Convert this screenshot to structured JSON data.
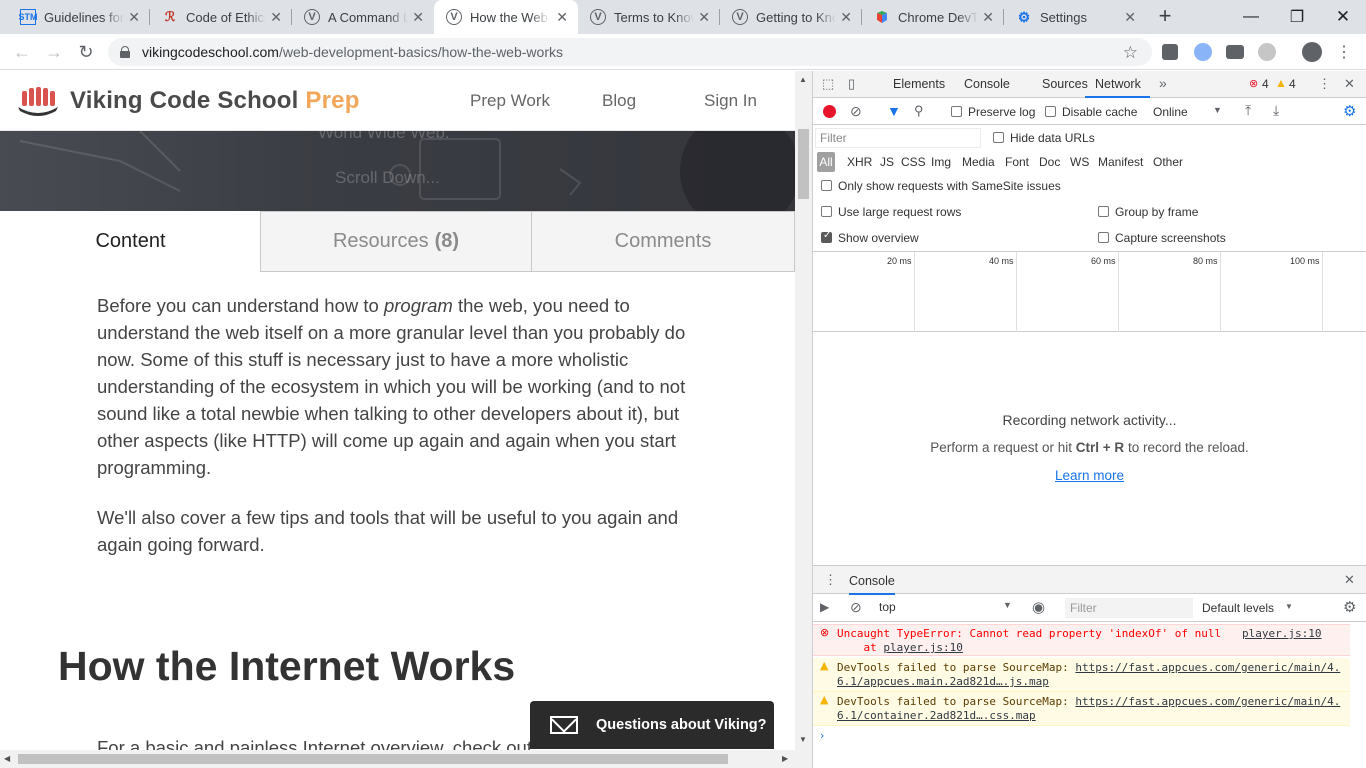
{
  "browser": {
    "tabs": [
      {
        "title": "Guidelines for Social Media",
        "favicon": "STM"
      },
      {
        "title": "Code of Ethics",
        "favicon": "ethics-icon"
      },
      {
        "title": "A Command Line Crash Course",
        "favicon": "V"
      },
      {
        "title": "How the Web Works",
        "favicon": "V",
        "active": true
      },
      {
        "title": "Terms to Know",
        "favicon": "V"
      },
      {
        "title": "Getting to Know",
        "favicon": "V"
      },
      {
        "title": "Chrome DevTools",
        "favicon": "devtools-icon"
      },
      {
        "title": "Settings",
        "favicon": "gear-icon"
      }
    ],
    "url_host": "vikingcodeschool.com",
    "url_path": "/web-development-basics/how-the-web-works"
  },
  "site": {
    "brand_name": "Viking Code School",
    "brand_suffix": "Prep",
    "nav": [
      "Prep Work",
      "Blog",
      "Sign In"
    ],
    "hero_faint_text": "World Wide Web.",
    "hero_scroll_text": "Scroll Down...",
    "content_tabs": [
      {
        "label": "Content"
      },
      {
        "label": "Resources",
        "count": "(8)"
      },
      {
        "label": "Comments"
      }
    ],
    "paragraph1_before": "Before you can understand how to ",
    "paragraph1_em": "program",
    "paragraph1_after": " the web, you need to understand the web itself on a more granular level than you probably do now. Some of this stuff is necessary just to have a more wholistic understanding of the ecosystem in which you will be working (and to not sound like a total newbie when talking to other developers about it), but other aspects (like HTTP) will come up again and again when you start programming.",
    "paragraph2": "We'll also cover a few tips and tools that will be useful to you again and again going forward.",
    "heading": "How the Internet Works",
    "cut_text": "For a basic and painless Internet overview, check out",
    "chat_button": "Questions about Viking?"
  },
  "devtools": {
    "tabs": [
      "Elements",
      "Console",
      "Sources",
      "Network"
    ],
    "active_tab": "Network",
    "error_count": "4",
    "warning_count": "4",
    "preserve_log": "Preserve log",
    "disable_cache": "Disable cache",
    "throttle": "Online",
    "filter_placeholder": "Filter",
    "hide_data_urls": "Hide data URLs",
    "filter_types": [
      "All",
      "XHR",
      "JS",
      "CSS",
      "Img",
      "Media",
      "Font",
      "Doc",
      "WS",
      "Manifest",
      "Other"
    ],
    "samesite": "Only show requests with SameSite issues",
    "large_rows": "Use large request rows",
    "group_by_frame": "Group by frame",
    "show_overview": "Show overview",
    "capture_screenshots": "Capture screenshots",
    "timeline_ticks": [
      "20 ms",
      "40 ms",
      "60 ms",
      "80 ms",
      "100 ms"
    ],
    "recording": "Recording network activity...",
    "hint_before": "Perform a request or hit ",
    "hint_keys": "Ctrl + R",
    "hint_after": " to record the reload.",
    "learn_more": "Learn more",
    "drawer_tab": "Console",
    "context": "top",
    "console_filter": "Filter",
    "levels": "Default levels",
    "messages": [
      {
        "type": "error",
        "text": "Uncaught TypeError: Cannot read property 'indexOf' of null",
        "source": "player.js:10",
        "detail_prefix": "    at ",
        "detail_link": "player.js:10"
      },
      {
        "type": "warning",
        "text": "DevTools failed to parse SourceMap: ",
        "link": "https://fast.appcues.com/generic/main/4.6.1/appcues.main.2ad821d….js.map"
      },
      {
        "type": "warning",
        "text": "DevTools failed to parse SourceMap: ",
        "link": "https://fast.appcues.com/generic/main/4.6.1/container.2ad821d….css.map"
      }
    ]
  },
  "colors": {
    "brand_accent": "#f2a65a",
    "devtools_accent": "#1a73e8",
    "record_red": "#e8142b"
  }
}
